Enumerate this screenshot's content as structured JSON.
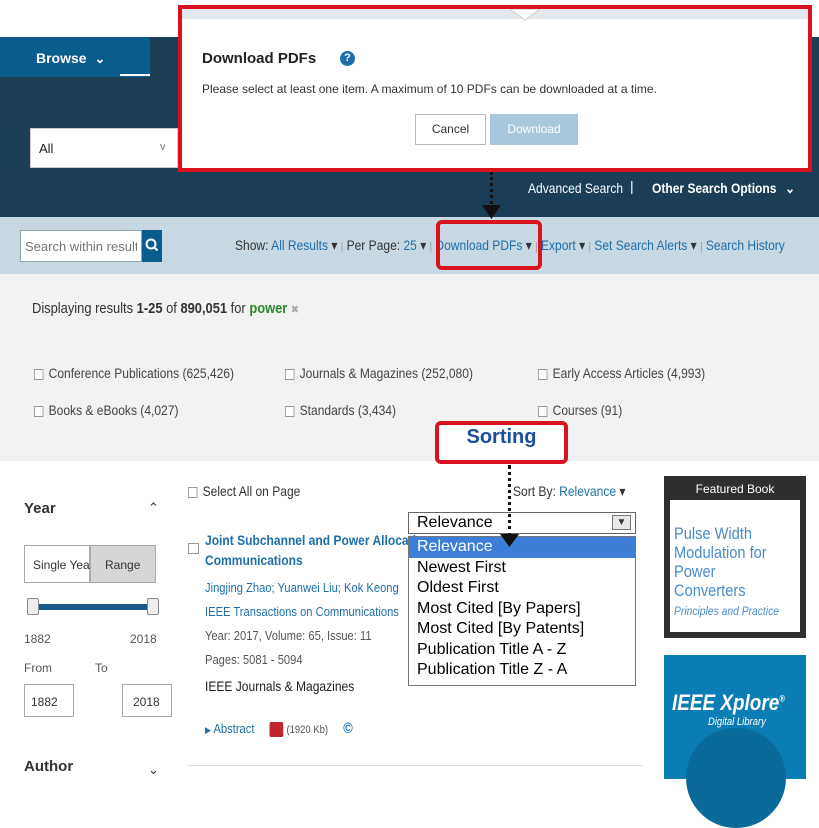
{
  "header": {
    "browse_label": "Browse",
    "browse_caret": "⌄",
    "scope_value": "All",
    "scope_caret": "v",
    "advanced_search": "Advanced Search",
    "separator": "|",
    "other_search": "Other Search Options",
    "other_search_caret": "⌄"
  },
  "toolbar": {
    "search_placeholder": "Search within results",
    "show_label": "Show:",
    "show_value": "All Results",
    "per_page_label": "Per Page:",
    "per_page_value": "25",
    "download_pdfs": "Download PDFs",
    "export": "Export",
    "set_search_alerts": "Set Search Alerts",
    "search_history": "Search History",
    "caret": "▾",
    "pipe": "|"
  },
  "results_summary": {
    "prefix": "Displaying results",
    "range": "1-25",
    "of": "of",
    "total": "890,051",
    "for": "for",
    "query": "power",
    "clear": "✖"
  },
  "facets": [
    "Conference Publications (625,426)",
    "Journals & Magazines (252,080)",
    "Early Access Articles (4,993)",
    "Books & eBooks (4,027)",
    "Standards (3,434)",
    "Courses (91)"
  ],
  "sidebar": {
    "year_title": "Year",
    "year_caret": "⌃",
    "single_year": "Single Year",
    "range": "Range",
    "min_year": "1882",
    "max_year": "2018",
    "from_label": "From",
    "to_label": "To",
    "from_value": "1882",
    "to_value": "2018",
    "author_title": "Author",
    "author_caret": "⌄"
  },
  "results": {
    "select_all": "Select All on Page",
    "sort_by_label": "Sort By:",
    "sort_by_value": "Relevance",
    "sort_caret": "▾",
    "item": {
      "title_line1": "Joint Subchannel and Power Allocati",
      "title_line2": "Communications",
      "authors": "Jingjing Zhao; Yuanwei Liu; Kok Keong",
      "publication": "IEEE Transactions on Communications",
      "year_vol": "Year: 2017, Volume: 65, Issue: 11",
      "pages": "Pages: 5081 - 5094",
      "publisher": "IEEE Journals & Magazines",
      "abstract": "Abstract",
      "pdf_size": "(1920 Kb)",
      "copyright": "©"
    }
  },
  "sort_dropdown": {
    "selected": "Relevance",
    "options": [
      "Relevance",
      "Newest First",
      "Oldest First",
      "Most Cited [By Papers]",
      "Most Cited [By Patents]",
      "Publication Title A - Z",
      "Publication Title Z - A"
    ]
  },
  "featured": {
    "label": "Featured Book",
    "book_title": "Pulse Width Modulation for Power Converters",
    "book_subtitle": "Principles and Practice",
    "xplore_title": "IEEE Xplore",
    "xplore_reg": "®",
    "xplore_sub": "Digital Library"
  },
  "popup": {
    "title": "Download PDFs",
    "help": "?",
    "message": "Please select at least one item. A maximum of 10 PDFs can be downloaded at a time.",
    "cancel": "Cancel",
    "download": "Download"
  },
  "annotations": {
    "sorting_label": "Sorting"
  },
  "colors": {
    "header_bg": "#1a3e55",
    "accent": "#0a5c8c",
    "annotation_red": "#d8121f",
    "link": "#1e6fa8",
    "selected_option": "#3d7fd6"
  }
}
